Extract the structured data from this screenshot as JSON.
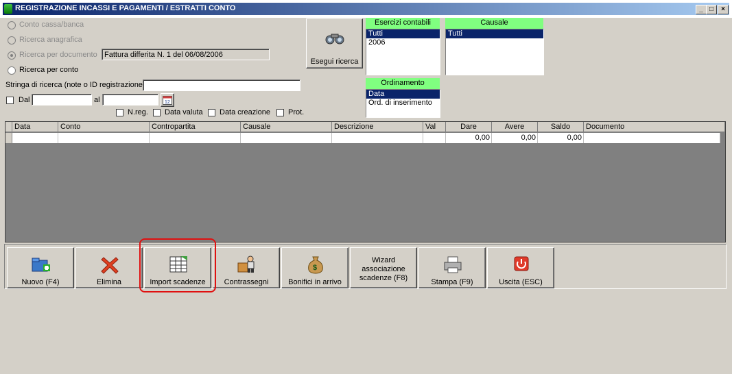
{
  "window": {
    "title": "REGISTRAZIONE INCASSI E PAGAMENTI / ESTRATTI CONTO",
    "minimize": "_",
    "restore": "□",
    "close": "×"
  },
  "search_options": {
    "conto_cassa": "Conto cassa/banca",
    "ricerca_anagrafica": "Ricerca anagrafica",
    "ricerca_documento": "Ricerca per documento",
    "documento_value": "Fattura differita N. 1 del 06/08/2006",
    "ricerca_conto": "Ricerca per conto"
  },
  "search_string": {
    "label": "Stringa di ricerca (note o ID registrazione)",
    "value": ""
  },
  "date_range": {
    "dal_label": "Dal",
    "al_label": "al",
    "dal_value": "",
    "al_value": ""
  },
  "sort_checks": {
    "nreg": "N.reg.",
    "data_valuta": "Data valuta",
    "data_creazione": "Data creazione",
    "prot": "Prot."
  },
  "esegui_button": "Esegui ricerca",
  "esercizi": {
    "header": "Esercizi contabili",
    "items": [
      "Tutti",
      "2006"
    ]
  },
  "causale": {
    "header": "Causale",
    "items": [
      "Tutti"
    ]
  },
  "ordinamento": {
    "header": "Ordinamento",
    "items": [
      "Data",
      "Ord. di inserimento"
    ]
  },
  "grid": {
    "columns": [
      "Data",
      "Conto",
      "Contropartita",
      "Causale",
      "Descrizione",
      "Val",
      "Dare",
      "Avere",
      "Saldo",
      "Documento"
    ],
    "rows": [
      {
        "data": "",
        "conto": "",
        "contropartita": "",
        "causale": "",
        "descrizione": "",
        "val": "",
        "dare": "0,00",
        "avere": "0,00",
        "saldo": "0,00",
        "documento": ""
      }
    ]
  },
  "toolbar": {
    "nuovo": "Nuovo (F4)",
    "elimina": "Elimina",
    "import": "Import scadenze",
    "contrassegni": "Contrassegni",
    "bonifici": "Bonifici in arrivo",
    "wizard_line1": "Wizard",
    "wizard_line2": "associazione",
    "wizard_line3": "scadenze (F8)",
    "stampa": "Stampa (F9)",
    "uscita": "Uscita (ESC)"
  },
  "colors": {
    "title_start": "#0a246a",
    "title_end": "#a6caf0",
    "list_header": "#80ff80",
    "selection": "#0a246a",
    "highlight": "#e01010"
  }
}
